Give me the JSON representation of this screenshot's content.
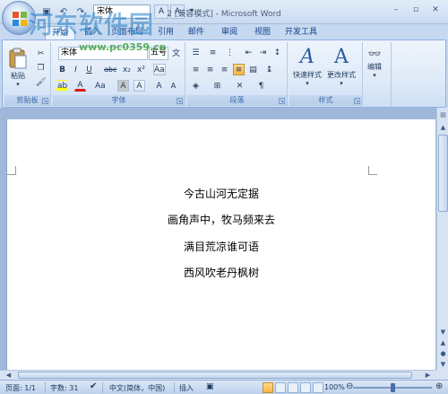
{
  "watermark": {
    "text": "河东软件园",
    "url": "www.pc0359.cn"
  },
  "titlebar": {
    "title": "2 [兼容模式] - Microsoft Word",
    "qat_font": "宋体",
    "qat_size_grow": "A",
    "qat_size_shrink": "A",
    "qat_more": "▾",
    "minimize": "–",
    "maximize": "▫",
    "close": "✕"
  },
  "tabs": [
    {
      "label": "开始",
      "active": true
    },
    {
      "label": "插入",
      "active": false
    },
    {
      "label": "页面布局",
      "active": false
    },
    {
      "label": "引用",
      "active": false
    },
    {
      "label": "邮件",
      "active": false
    },
    {
      "label": "审阅",
      "active": false
    },
    {
      "label": "视图",
      "active": false
    },
    {
      "label": "开发工具",
      "active": false
    }
  ],
  "ribbon": {
    "clipboard": {
      "label": "剪贴板",
      "paste": "粘贴"
    },
    "font": {
      "label": "字体",
      "font_name": "宋体",
      "font_size": "五号",
      "bold": "B",
      "italic": "I",
      "underline": "U",
      "strike": "abc",
      "sub": "x₂",
      "sup": "x²",
      "clear": "Aa",
      "highlight": "ab",
      "font_color": "A",
      "case": "Aa",
      "char_shade": "A",
      "char_border": "A",
      "grow": "A",
      "shrink": "A"
    },
    "paragraph": {
      "label": "段落"
    },
    "styles": {
      "label": "样式",
      "quick_styles": "快速样式",
      "change_styles": "更改样式"
    },
    "editing": {
      "label": "编辑"
    }
  },
  "document": {
    "lines": [
      "今古山河无定据",
      "画角声中，牧马频来去",
      "满目荒凉谁可语",
      "西风吹老丹枫树"
    ]
  },
  "statusbar": {
    "page": "页面: 1/1",
    "words": "字数: 31",
    "language": "中文(简体，中国)",
    "insert": "插入",
    "zoom": "100%"
  }
}
